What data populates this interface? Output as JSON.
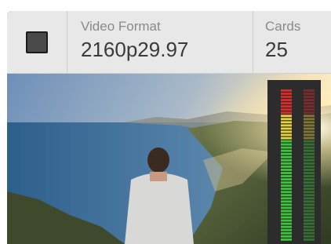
{
  "header": {
    "stop_button": "stop-icon",
    "video_format_label": "Video Format",
    "video_format_value": "2160p29.97",
    "cards_label": "Cards",
    "cards_value": "25"
  },
  "audio_meters": {
    "channels": 2,
    "level_left": 1.0,
    "level_right": 1.0
  },
  "colors": {
    "meter_green": "#3ec43a",
    "meter_yellow": "#e6d23a",
    "meter_red": "#d92b2b"
  }
}
